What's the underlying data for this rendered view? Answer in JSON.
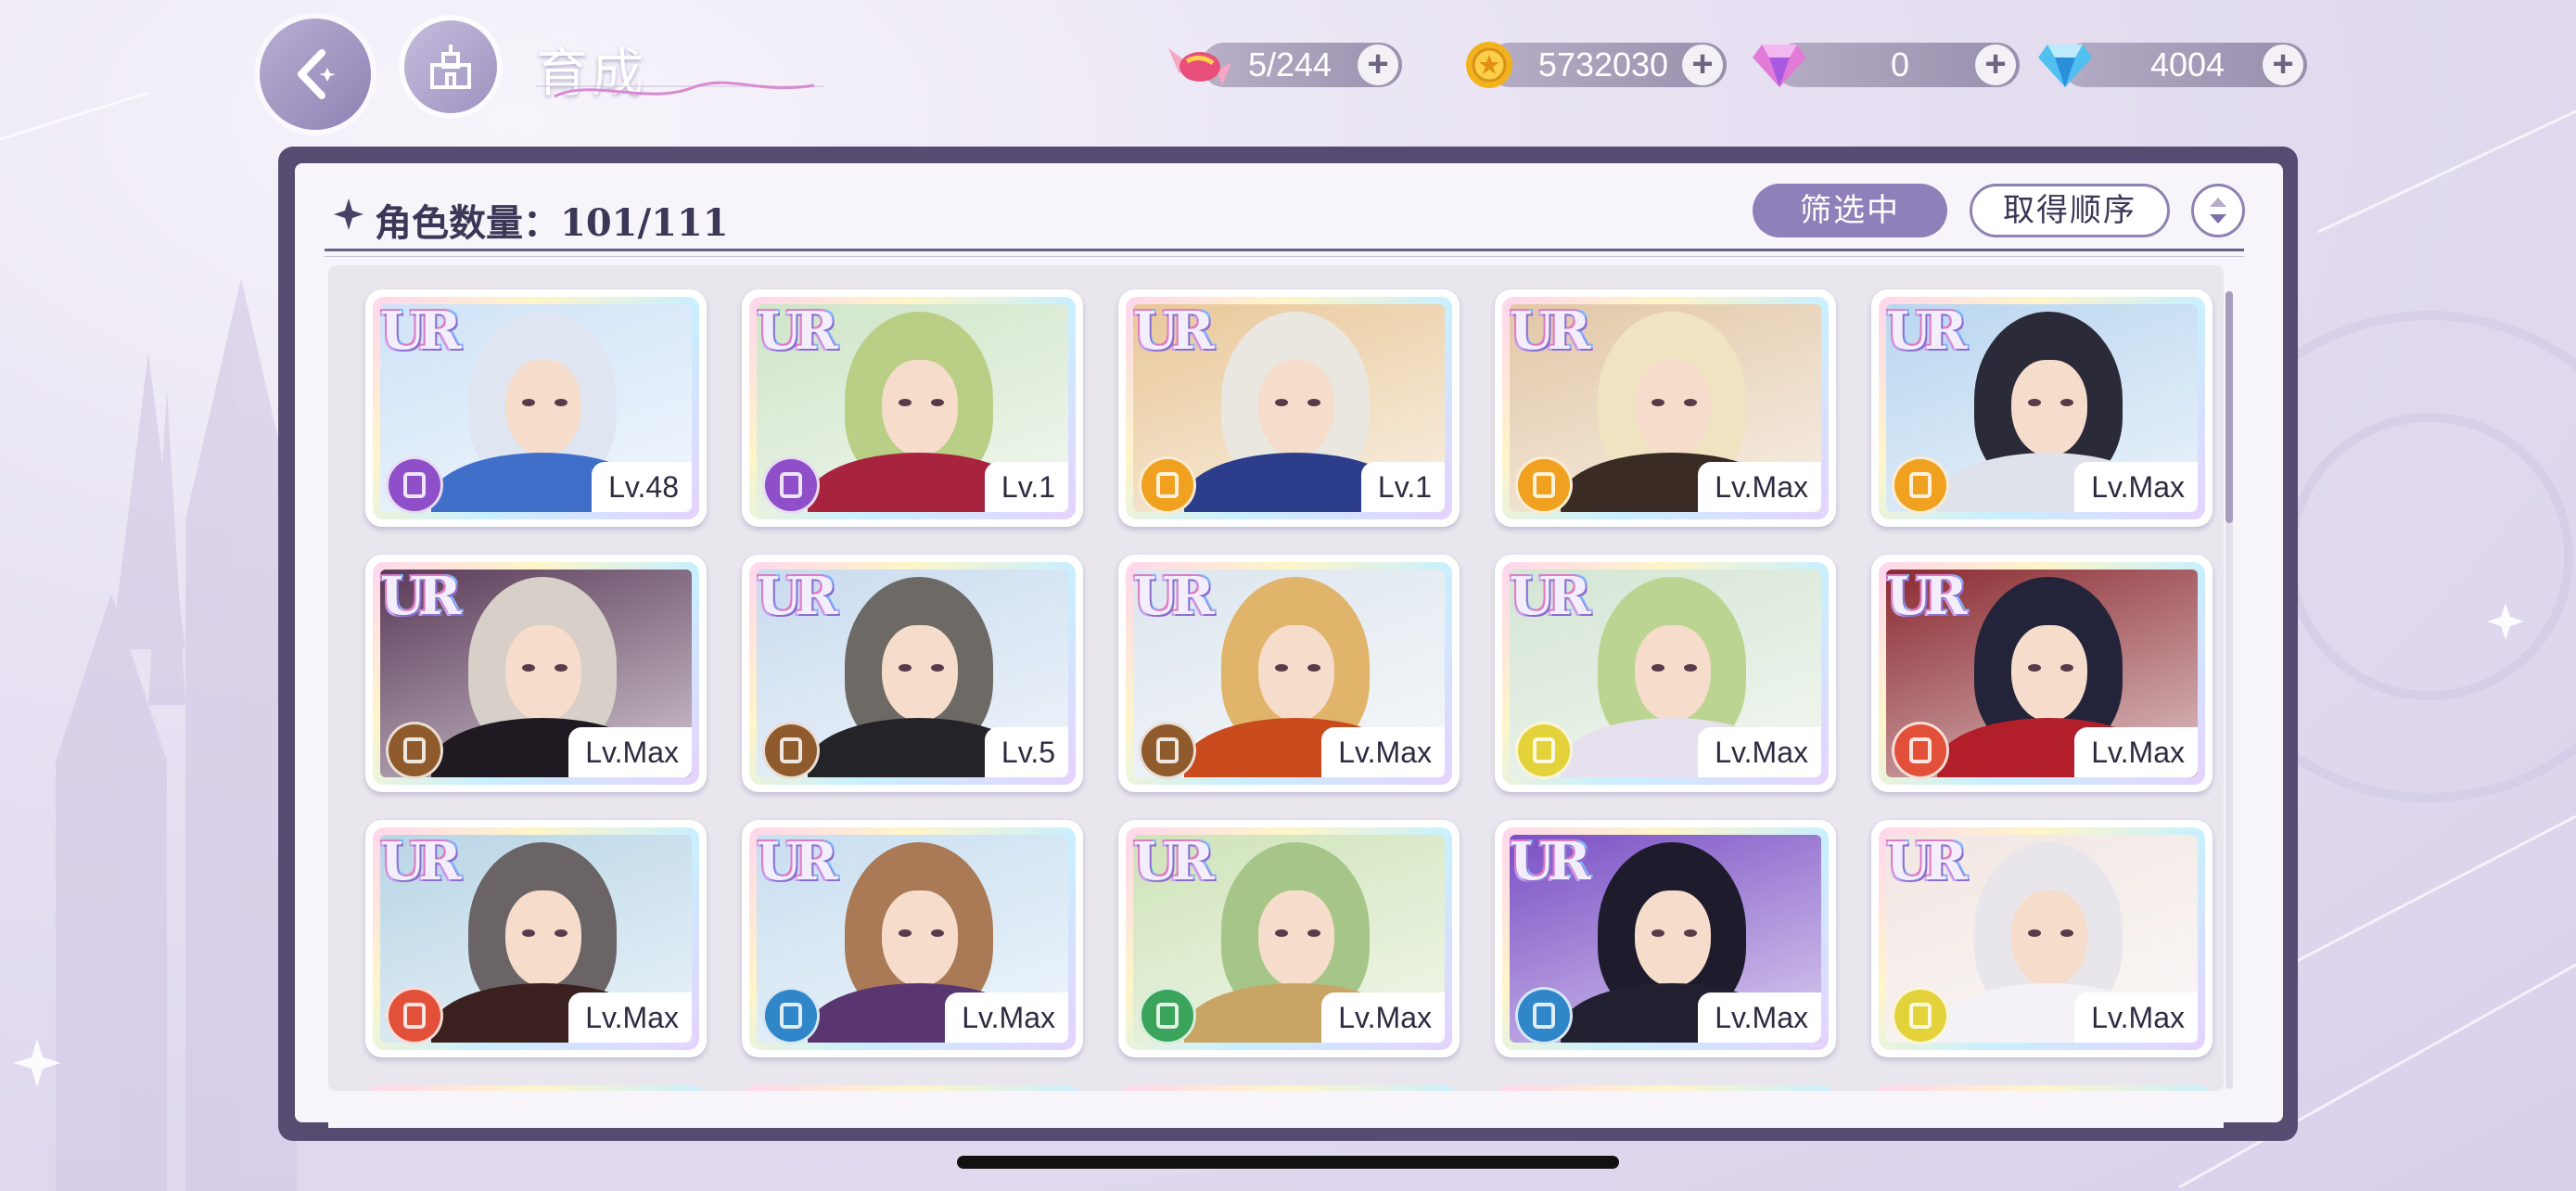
{
  "header": {
    "title": "育成",
    "resources": [
      {
        "name": "candy",
        "value": "5/244"
      },
      {
        "name": "gold-coin",
        "value": "5732030"
      },
      {
        "name": "pink-gem",
        "value": "0"
      },
      {
        "name": "blue-diamond",
        "value": "4004"
      }
    ]
  },
  "panel": {
    "count_label": "角色数量：101/111",
    "filter_button": "筛选中",
    "sort_button": "取得顺序"
  },
  "cards": [
    {
      "rarity": "UR",
      "level": "Lv.48",
      "attr": "purple",
      "hair": "#dfe6f2",
      "outfit": "#3f6fc9",
      "bg": "#cfe2f7",
      "attr_color": "#8e4fc8"
    },
    {
      "rarity": "UR",
      "level": "Lv.1",
      "attr": "purple",
      "hair": "#b9cf86",
      "outfit": "#a8243e",
      "bg": "#cfe5c8",
      "attr_color": "#8e4fc8"
    },
    {
      "rarity": "UR",
      "level": "Lv.1",
      "attr": "orange",
      "hair": "#eae7e0",
      "outfit": "#2c3d8c",
      "bg": "#e9c899",
      "attr_color": "#f0a120"
    },
    {
      "rarity": "UR",
      "level": "Lv.Max",
      "attr": "orange",
      "hair": "#efe3c2",
      "outfit": "#3a2c24",
      "bg": "#e2c7a6",
      "attr_color": "#f0a120"
    },
    {
      "rarity": "UR",
      "level": "Lv.Max",
      "attr": "orange",
      "hair": "#2b2a38",
      "outfit": "#dfe2ea",
      "bg": "#b9d6f0",
      "attr_color": "#f0a120"
    },
    {
      "rarity": "UR",
      "level": "Lv.Max",
      "attr": "brown",
      "hair": "#d7d0c8",
      "outfit": "#1f1a22",
      "bg": "#5a3a58",
      "attr_color": "#8f5a2c"
    },
    {
      "rarity": "UR",
      "level": "Lv.5",
      "attr": "brown",
      "hair": "#6d6a66",
      "outfit": "#242328",
      "bg": "#c9dbef",
      "attr_color": "#8f5a2c"
    },
    {
      "rarity": "UR",
      "level": "Lv.Max",
      "attr": "brown",
      "hair": "#e0b46a",
      "outfit": "#c84a1d",
      "bg": "#dde6ee",
      "attr_color": "#8f5a2c"
    },
    {
      "rarity": "UR",
      "level": "Lv.Max",
      "attr": "yellow",
      "hair": "#bcd491",
      "outfit": "#e7e1ef",
      "bg": "#d4e5d3",
      "attr_color": "#e4d23a"
    },
    {
      "rarity": "UR",
      "level": "Lv.Max",
      "attr": "red",
      "hair": "#23243a",
      "outfit": "#b21e2a",
      "bg": "#8a2a30",
      "attr_color": "#e2503a"
    },
    {
      "rarity": "UR",
      "level": "Lv.Max",
      "attr": "red",
      "hair": "#6a6466",
      "outfit": "#3b2020",
      "bg": "#b8d5e6",
      "attr_color": "#e2503a"
    },
    {
      "rarity": "UR",
      "level": "Lv.Max",
      "attr": "blue",
      "hair": "#a97a55",
      "outfit": "#5a3670",
      "bg": "#c8def0",
      "attr_color": "#2f86c9"
    },
    {
      "rarity": "UR",
      "level": "Lv.Max",
      "attr": "green",
      "hair": "#a6c689",
      "outfit": "#c8a564",
      "bg": "#cfe3b9",
      "attr_color": "#3aa45a"
    },
    {
      "rarity": "UR",
      "level": "Lv.Max",
      "attr": "blue",
      "hair": "#1e1c2c",
      "outfit": "#222030",
      "bg": "#7a4fc5",
      "attr_color": "#2f86c9"
    },
    {
      "rarity": "UR",
      "level": "Lv.Max",
      "attr": "yellow",
      "hair": "#e8e6ea",
      "outfit": "#f4f2f7",
      "bg": "#f1e6e2",
      "attr_color": "#e4d23a"
    }
  ]
}
